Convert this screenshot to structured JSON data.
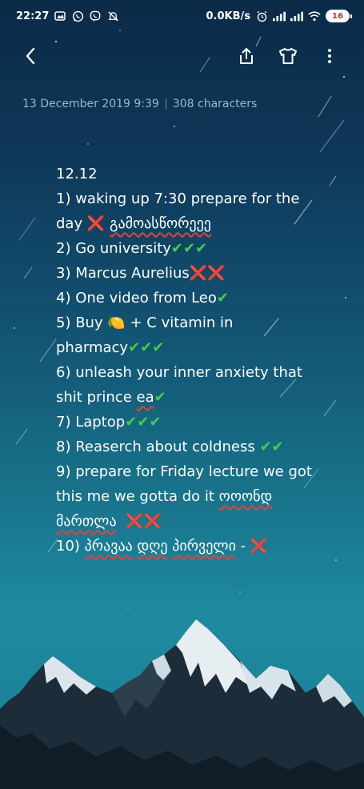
{
  "status_bar": {
    "time": "22:27",
    "net_speed": "0.0KB/s",
    "battery": "16"
  },
  "toolbar": {
    "back_icon": "chevron-left-icon",
    "share_icon": "share-icon",
    "shirt_icon": "tshirt-icon",
    "more_icon": "more-vertical-icon"
  },
  "meta": {
    "date": "13 December 2019  9:39",
    "chars": "308 characters"
  },
  "note": {
    "l1": "12.12",
    "l2": "1) waking up 7:30 prepare for the",
    "l3a": "day ",
    "l3b": "❌",
    "l3c": " ",
    "l3d": "გამოასწორეეე",
    "l4a": "2) Go university",
    "l4b": "✔✔✔",
    "l5a": "3) Marcus Aurelius",
    "l5b": "❌❌",
    "l6a": "4) One video from Leo",
    "l6b": "✔",
    "l7a": "5) Buy ",
    "l7b": "🍋",
    "l7c": " + C vitamin in",
    "l8a": "pharmacy",
    "l8b": "✔✔✔",
    "l9": "6) unleash your inner anxiety that",
    "l10a": "shit prince ",
    "l10b": "ea",
    "l10c": "✔",
    "l11a": "7) Laptop",
    "l11b": "✔✔✔",
    "l12a": "8)  Reaserch about coldness ",
    "l12b": "✔✔",
    "l13": "9) prepare for Friday lecture we got",
    "l14a": "this me we gotta do it ",
    "l14b": "ოოონდ",
    "l15a": "მართლა",
    "l15b": "  ",
    "l15c": "❌❌",
    "l16a": "10) ",
    "l16b": "პრავაა",
    "l16c": " ",
    "l16d": "დღე",
    "l16e": " ",
    "l16f": "პირველი",
    "l16g": " - ",
    "l16h": "❌"
  },
  "colors": {
    "check": "#3fcf4a",
    "cross": "#e05a3a",
    "meta_text": "#9ab6c8"
  }
}
